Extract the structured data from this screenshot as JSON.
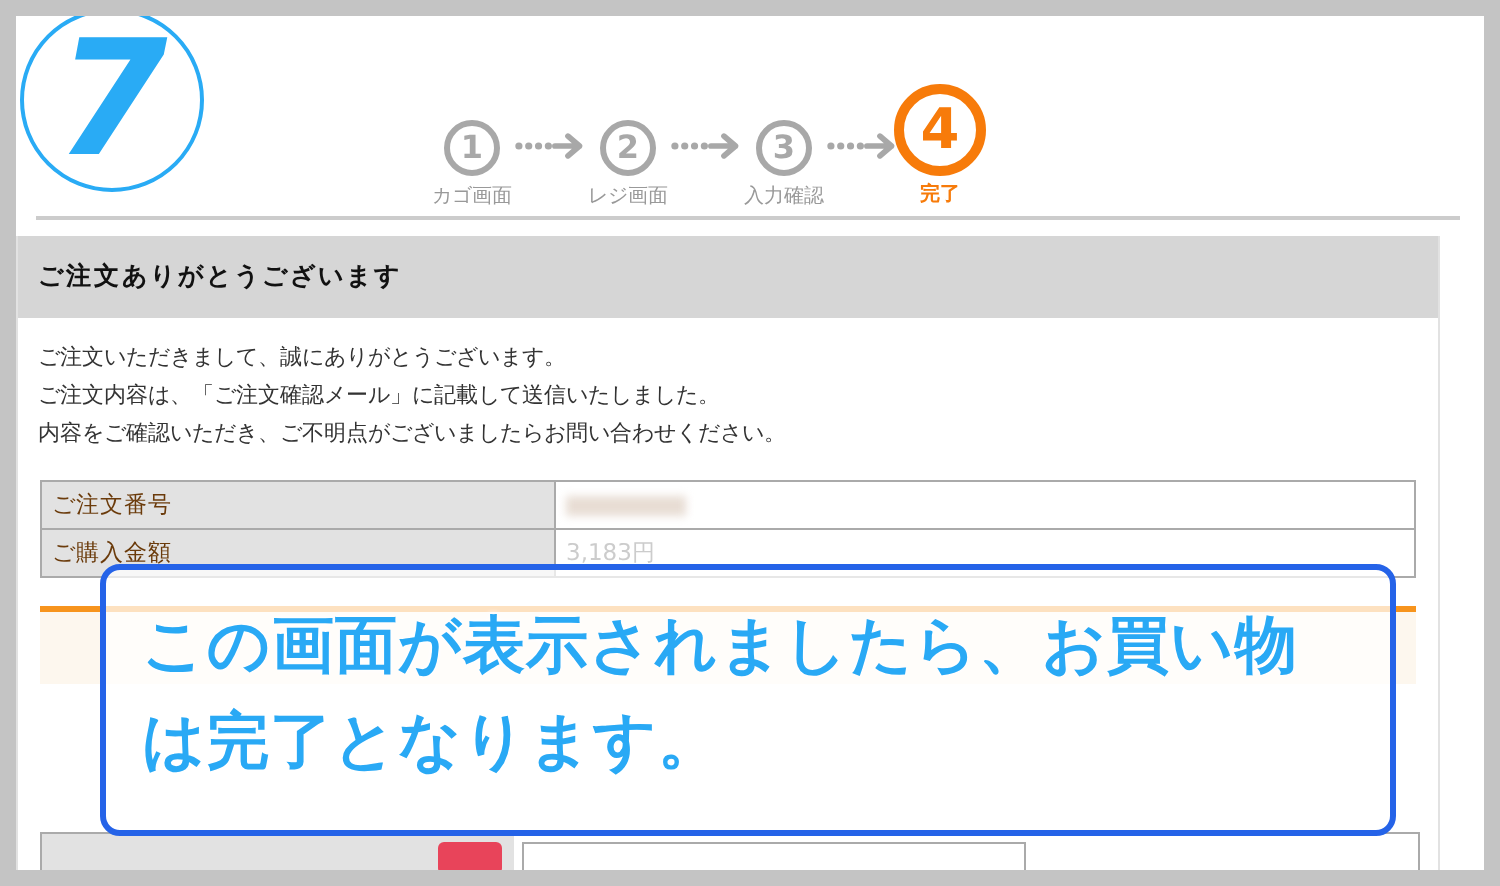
{
  "step_badge": {
    "text": "7"
  },
  "steps": [
    {
      "number": "1",
      "label": "カゴ画面",
      "selected": false
    },
    {
      "number": "2",
      "label": "レジ画面",
      "selected": false
    },
    {
      "number": "3",
      "label": "入力確認",
      "selected": false
    },
    {
      "number": "4",
      "label": "完了",
      "selected": true
    }
  ],
  "panel": {
    "title": "ご注文ありがとうございます",
    "message_lines": [
      "ご注文いただきまして、誠にありがとうございます。",
      "ご注文内容は、「ご注文確認メール」に記載して送信いたしました。",
      "内容をご確認いただき、ご不明点がございましたらお問い合わせください。"
    ],
    "order_table": [
      {
        "label": "ご注文番号",
        "kind": "blurred"
      },
      {
        "label": "ご購入金額",
        "kind": "text",
        "value": "3,183円"
      }
    ]
  },
  "callout": {
    "text": "この画面が表示されましたら、お買い物は完了となります。"
  }
}
